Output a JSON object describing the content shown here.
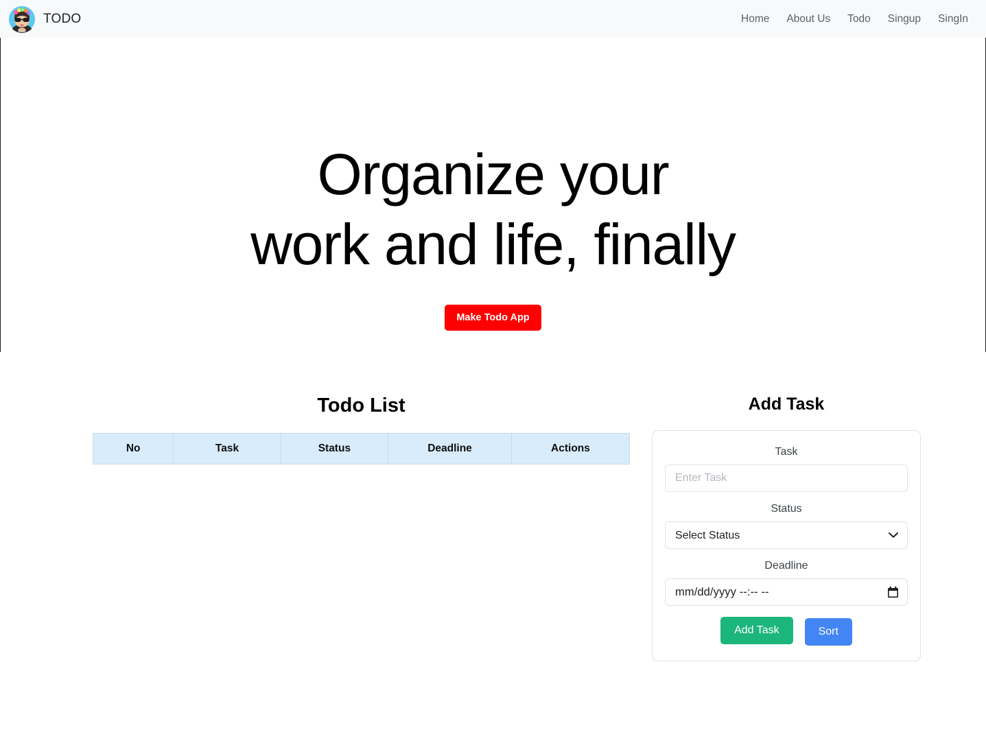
{
  "navbar": {
    "brand_label": "TODO",
    "avatar_icon": "avatar-icon",
    "links": [
      {
        "label": "Home"
      },
      {
        "label": "About Us"
      },
      {
        "label": "Todo"
      },
      {
        "label": "Singup"
      },
      {
        "label": "SingIn"
      }
    ]
  },
  "hero": {
    "title_line1": "Organize your",
    "title_line2": "work and life, finally",
    "cta_label": "Make Todo App",
    "cta_color": "#fe0000"
  },
  "todo_list": {
    "heading": "Todo List",
    "columns": [
      "No",
      "Task",
      "Status",
      "Deadline",
      "Actions"
    ],
    "rows": [],
    "header_bg": "#d8ecfb"
  },
  "add_task": {
    "heading": "Add Task",
    "task": {
      "label": "Task",
      "placeholder": "Enter Task",
      "value": ""
    },
    "status": {
      "label": "Status",
      "selected": "Select Status",
      "options": [
        "Select Status"
      ],
      "chevron_icon": "chevron-down-icon"
    },
    "deadline": {
      "label": "Deadline",
      "placeholder": "mm/dd/yyyy --:-- --",
      "date_part": "mm/dd/yyyy",
      "time_part": "--:-- --",
      "calendar_icon": "calendar-icon"
    },
    "buttons": {
      "add_label": "Add Task",
      "add_color": "#1cb57b",
      "sort_label": "Sort",
      "sort_color": "#4285f4"
    }
  }
}
